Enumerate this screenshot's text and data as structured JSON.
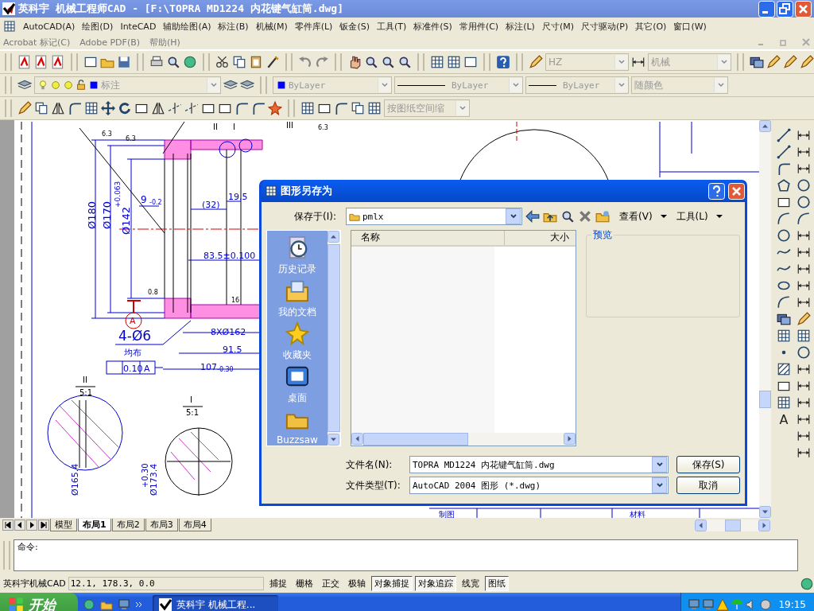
{
  "window": {
    "title": "英科宇 机械工程师CAD - [F:\\TOPRA MD1224 内花键气缸筒.dwg]"
  },
  "menu_bar": {
    "row_1": [
      "AutoCAD(A)",
      "绘图(D)",
      "InteCAD",
      "辅助绘图(A)",
      "标注(B)",
      "机械(M)",
      "零件库(L)",
      "钣金(S)",
      "工具(T)",
      "标准件(S)",
      "常用件(C)",
      "标注(L)",
      "尺寸(M)",
      "尺寸驱动(P)",
      "其它(O)",
      "窗口(W)"
    ],
    "row_2": [
      "Acrobat 标记(C)",
      "Adobe PDF(B)",
      "帮助(H)"
    ]
  },
  "toolbars": {
    "text_style": "HZ",
    "dim_style": "机械",
    "layer": "标注",
    "color_control": "ByLayer",
    "linetype": "ByLayer",
    "lineweight": "ByLayer",
    "plot_style": "随颜色",
    "viewport_scale": "按图纸空间缩"
  },
  "drawing": {
    "labels": [
      "6.3",
      "6.3",
      "Ø180",
      "Ø170",
      "Ø142",
      "+0.063",
      "9",
      "-0.2",
      "(32)",
      "19.5",
      "83.5±0.100",
      "0.8",
      "16",
      "A",
      "4-Ø6",
      "均布",
      "8XØ162",
      "91.5",
      "0.10",
      "A",
      "107",
      "-0.30",
      "II",
      "5:1",
      "I",
      "5:1",
      "II",
      "I",
      "III",
      "6.3",
      "Ø165.4",
      "Ø173.4",
      "+0.30",
      "制图",
      "材料"
    ]
  },
  "right_toolbar": {
    "text_tool": "A"
  },
  "layout_tabs": [
    {
      "label": "模型",
      "selected": false
    },
    {
      "label": "布局1",
      "selected": true
    },
    {
      "label": "布局2",
      "selected": false
    },
    {
      "label": "布局3",
      "selected": false
    },
    {
      "label": "布局4",
      "selected": false
    }
  ],
  "command_line": {
    "prompt": "命令:"
  },
  "status_bar": {
    "app": "英科宇机械CAD",
    "coordinates": "12.1, 178.3, 0.0",
    "toggles": [
      {
        "label": "捕捉",
        "on": false
      },
      {
        "label": "栅格",
        "on": false
      },
      {
        "label": "正交",
        "on": false
      },
      {
        "label": "极轴",
        "on": false
      },
      {
        "label": "对象捕捉",
        "on": true
      },
      {
        "label": "对象追踪",
        "on": true
      },
      {
        "label": "线宽",
        "on": false
      },
      {
        "label": "图纸",
        "on": true
      }
    ]
  },
  "dialog": {
    "title": "图形另存为",
    "save_in_label": "保存于(I):",
    "save_in": "pmlx",
    "view_menu": "查看(V)",
    "tools_menu": "工具(L)",
    "places": [
      "历史记录",
      "我的文档",
      "收藏夹",
      "桌面",
      "Buzzsaw"
    ],
    "columns": [
      "名称",
      "大小"
    ],
    "preview_label": "预览",
    "file_name_label": "文件名(N):",
    "file_name": "TOPRA MD1224 内花键气缸筒.dwg",
    "file_type_label": "文件类型(T):",
    "file_type": "AutoCAD 2004 图形 (*.dwg)",
    "buttons": [
      "保存(S)",
      "取消"
    ]
  },
  "taskbar": {
    "start": "开始",
    "tasks": [
      {
        "label": "英科宇 机械工程...",
        "selected": true
      }
    ],
    "clock": "19:15"
  }
}
